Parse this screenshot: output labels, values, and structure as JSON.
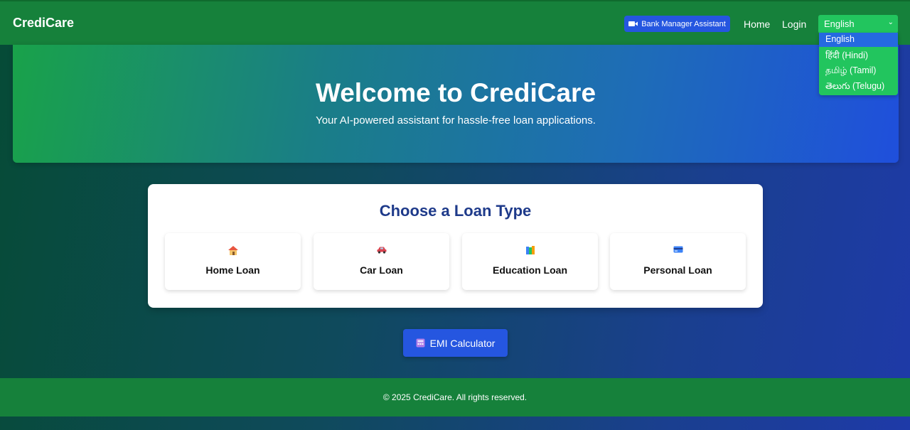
{
  "navbar": {
    "brand": "CrediCare",
    "assistant_button": {
      "icon": "video-camera-icon",
      "label": "Bank Manager Assistant"
    },
    "links": [
      "Home",
      "Login"
    ],
    "language": {
      "selected": "English",
      "options": [
        "English",
        "हिंदी (Hindi)",
        "தமிழ் (Tamil)",
        "తెలుగు (Telugu)"
      ]
    }
  },
  "hero": {
    "title": "Welcome to CrediCare",
    "subtitle": "Your AI-powered assistant for hassle-free loan applications."
  },
  "loans": {
    "title": "Choose a Loan Type",
    "options": [
      {
        "icon": "house-icon",
        "label": "Home Loan"
      },
      {
        "icon": "car-icon",
        "label": "Car Loan"
      },
      {
        "icon": "books-icon",
        "label": "Education Loan"
      },
      {
        "icon": "credit-card-icon",
        "label": "Personal Loan"
      }
    ]
  },
  "emi": {
    "icon": "calculator-icon",
    "label": "EMI Calculator"
  },
  "footer": {
    "text": "© 2025 CrediCare. All rights reserved."
  },
  "colors": {
    "header": "#16813b",
    "primary_button": "#2556e0",
    "language_select": "#22c55e",
    "card_title": "#1e3a8a"
  }
}
